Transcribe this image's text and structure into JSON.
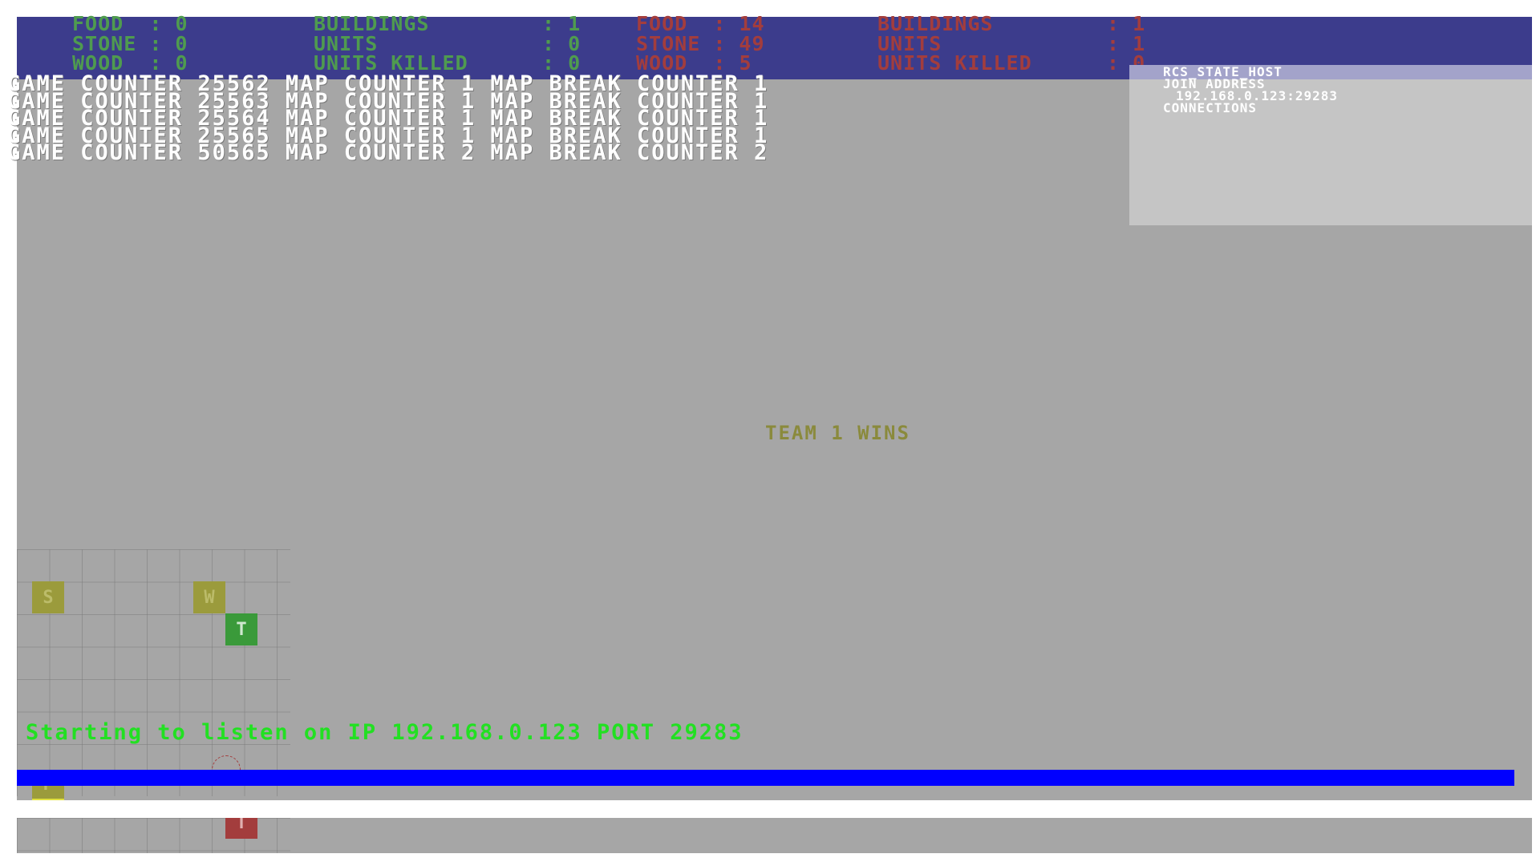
{
  "team1": {
    "color": "#4f9b4f",
    "food_label": "FOOD",
    "food": "0",
    "stone_label": "STONE",
    "stone": "0",
    "wood_label": "WOOD",
    "wood": "0",
    "buildings_label": "BUILDINGS",
    "buildings": "1",
    "units_label": "UNITS",
    "units": "0",
    "units_killed_label": "UNITS KILLED",
    "units_killed": "0"
  },
  "team2": {
    "color": "#a33d3d",
    "food_label": "FOOD",
    "food": "14",
    "stone_label": "STONE",
    "stone": "49",
    "wood_label": "WOOD",
    "wood": "5",
    "buildings_label": "BUILDINGS",
    "buildings": "1",
    "units_label": "UNITS",
    "units": "1",
    "units_killed_label": "UNITS KILLED",
    "units_killed": "0"
  },
  "debug_lines": [
    "GAME COUNTER 25562 MAP COUNTER 1 MAP BREAK COUNTER 1",
    "GAME COUNTER 25563 MAP COUNTER 1 MAP BREAK COUNTER 1",
    "GAME COUNTER 25564 MAP COUNTER 1 MAP BREAK COUNTER 1",
    "GAME COUNTER 25565 MAP COUNTER 1 MAP BREAK COUNTER 1",
    "GAME COUNTER 50565 MAP COUNTER 2 MAP BREAK COUNTER 2"
  ],
  "network": {
    "state": "RCS_STATE_HOST",
    "join_label": "JOIN ADDRESS",
    "join_address": "192.168.0.123:29283",
    "connections_label": "CONNECTIONS"
  },
  "win_message": "TEAM 1 WINS",
  "map_tiles": [
    {
      "letter": "S",
      "color": "#9b9b3c",
      "text_color": "#bcbc6a"
    },
    {
      "letter": "W",
      "color": "#9b9b3c",
      "text_color": "#bcbc6a"
    },
    {
      "letter": "T",
      "color": "#3a9a3a",
      "text_color": "#cfe8cf"
    },
    {
      "letter": "F",
      "color": "#9b9b3c",
      "text_color": "#bcbc6a"
    },
    {
      "letter": "T",
      "color": "#a33d3d",
      "text_color": "#e0b0b0"
    }
  ],
  "console": {
    "message": "Starting to listen on IP 192.168.0.123 PORT 29283",
    "input_value": "",
    "text_color": "#22e022",
    "bar_color": "#0000ff"
  }
}
